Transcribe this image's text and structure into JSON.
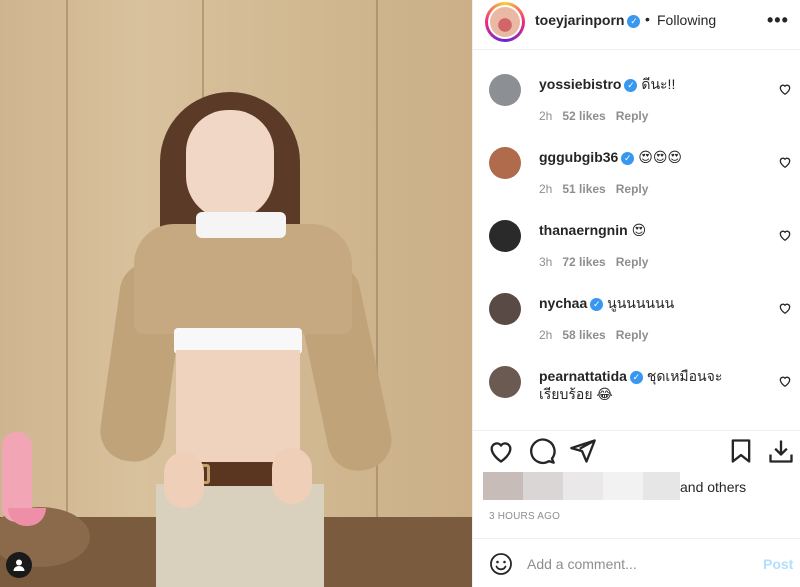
{
  "post": {
    "author": "toeyjarinporn",
    "separator": "•",
    "follow_status": "Following",
    "more_label": "•••"
  },
  "comments": [
    {
      "username": "yossiebistro",
      "text": "ดีนะ!!",
      "time": "2h",
      "likes": "52 likes",
      "reply": "Reply",
      "avatar_color": "#8c8f93"
    },
    {
      "username": "gggubgib36",
      "text": "😍😍😍",
      "time": "2h",
      "likes": "51 likes",
      "reply": "Reply",
      "avatar_color": "#b06a4c"
    },
    {
      "username": "thanaerngnin",
      "text": "😍",
      "time": "3h",
      "likes": "72 likes",
      "reply": "Reply",
      "avatar_color": "#2a2a2a"
    },
    {
      "username": "nychaa",
      "text": "นูนนนนนน",
      "time": "2h",
      "likes": "58 likes",
      "reply": "Reply",
      "avatar_color": "#5a4a45"
    },
    {
      "username": "pearnattatida",
      "text": "ชุดเหมือนจะเรียบร้อย 😂",
      "time": "",
      "likes": "",
      "reply": "",
      "avatar_color": "#6b5a52"
    }
  ],
  "actions": {
    "like_icon": "heart-outline-icon",
    "comment_icon": "comment-bubble-icon",
    "share_icon": "paper-plane-icon",
    "save_icon": "bookmark-icon",
    "download_icon": "download-icon"
  },
  "liked_by": {
    "suffix": "and others"
  },
  "timestamp": "3 HOURS AGO",
  "compose": {
    "placeholder": "Add a comment...",
    "post_label": "Post"
  },
  "colors": {
    "verified": "#3897f0",
    "muted": "#8e8e8e",
    "post_disabled": "#b2dffc",
    "notification": "#ed4956"
  }
}
